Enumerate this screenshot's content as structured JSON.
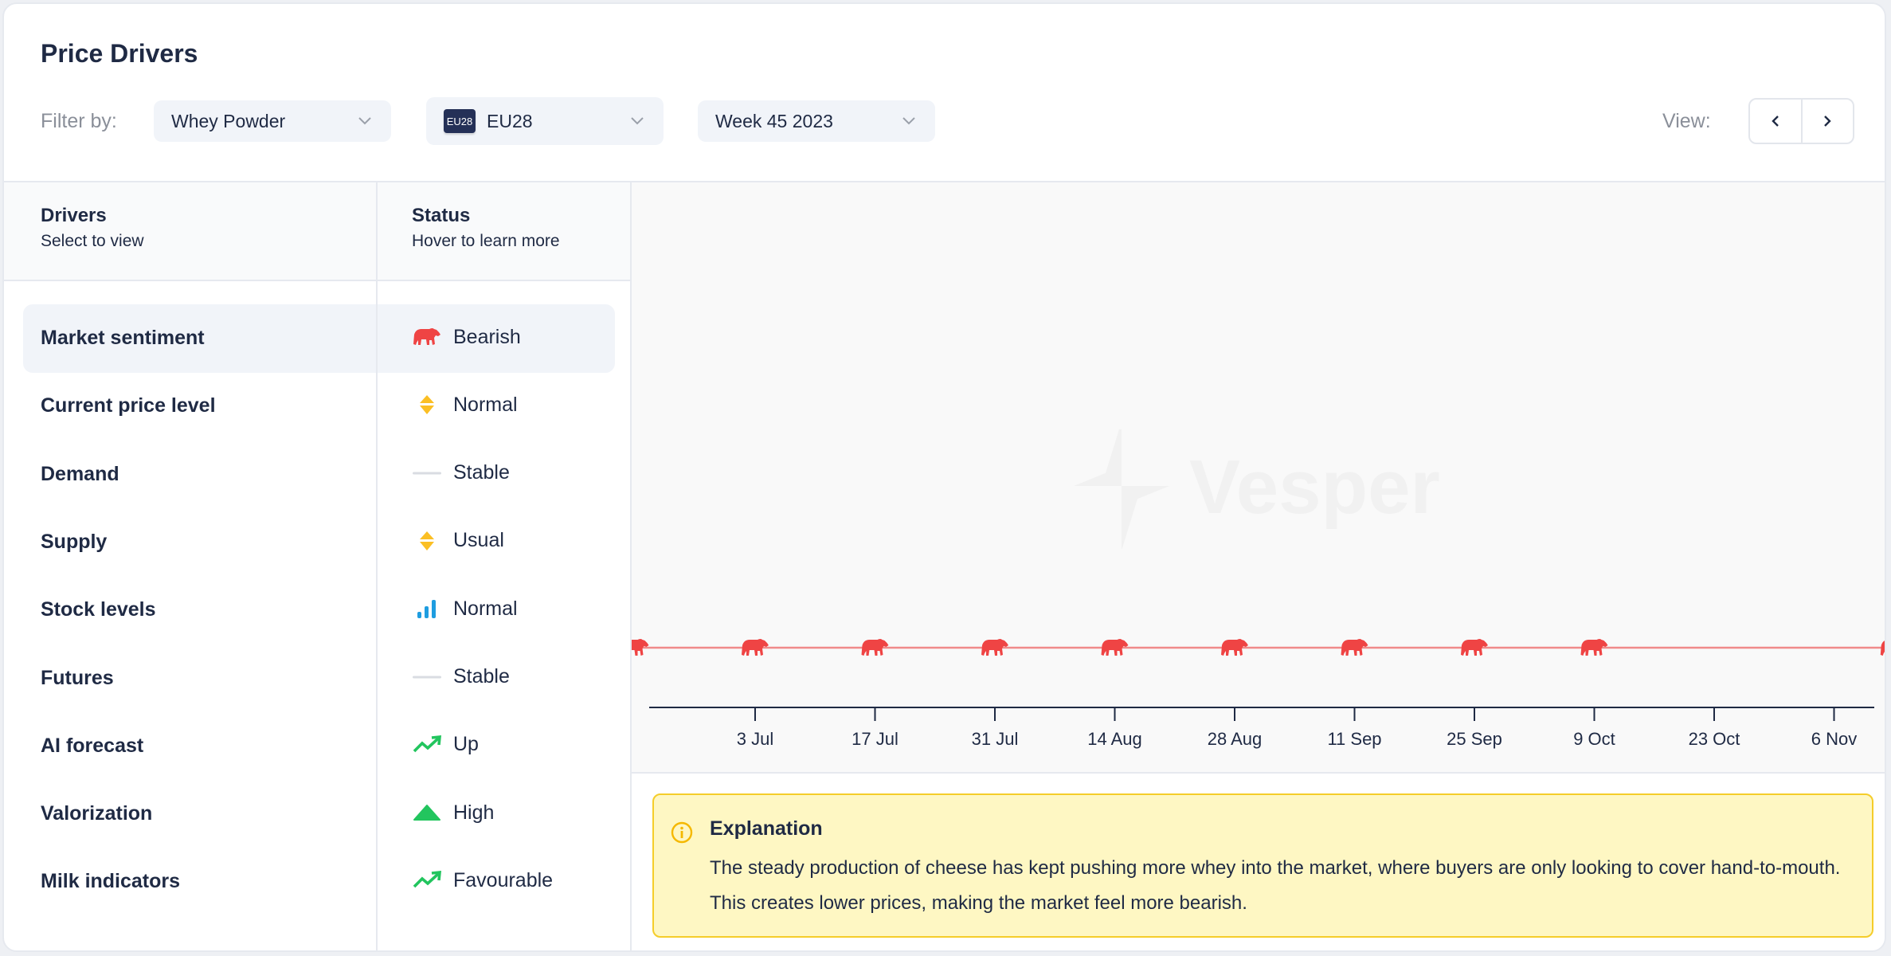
{
  "header": {
    "title": "Price Drivers",
    "filter_label": "Filter by:",
    "product_select": "Whey Powder",
    "region_select": {
      "flag_text": "EU28",
      "value": "EU28"
    },
    "week_select": "Week 45 2023",
    "view_label": "View:",
    "view_prev_icon": "chevron-left-icon",
    "view_next_icon": "chevron-right-icon"
  },
  "table": {
    "drivers_header": {
      "title": "Drivers",
      "subtitle": "Select to view"
    },
    "status_header": {
      "title": "Status",
      "subtitle": "Hover to learn more"
    },
    "selected_index": 0,
    "rows": [
      {
        "driver": "Market sentiment",
        "status": "Bearish",
        "icon": "bear-icon",
        "color": "#ef4444"
      },
      {
        "driver": "Current price level",
        "status": "Normal",
        "icon": "up-down-diamond-icon",
        "color": "#fbbf24"
      },
      {
        "driver": "Demand",
        "status": "Stable",
        "icon": "flat-line-icon",
        "color": "#d9dce2"
      },
      {
        "driver": "Supply",
        "status": "Usual",
        "icon": "up-down-diamond-icon",
        "color": "#fbbf24"
      },
      {
        "driver": "Stock levels",
        "status": "Normal",
        "icon": "bar-signal-icon",
        "color": "#1e9de0"
      },
      {
        "driver": "Futures",
        "status": "Stable",
        "icon": "flat-line-icon",
        "color": "#d9dce2"
      },
      {
        "driver": "AI forecast",
        "status": "Up",
        "icon": "trending-up-icon",
        "color": "#22c55e"
      },
      {
        "driver": "Valorization",
        "status": "High",
        "icon": "triangle-up-icon",
        "color": "#22c55e"
      },
      {
        "driver": "Milk indicators",
        "status": "Favourable",
        "icon": "trending-up-icon",
        "color": "#22c55e"
      }
    ]
  },
  "watermark": {
    "text": "Vesper"
  },
  "chart_data": {
    "type": "line",
    "title": "Market sentiment",
    "series": [
      {
        "name": "Market sentiment",
        "marker": "bear-icon",
        "color": "#ef4444",
        "points": [
          {
            "x": "19 Jun",
            "value": "Bearish"
          },
          {
            "x": "3 Jul",
            "value": "Bearish"
          },
          {
            "x": "17 Jul",
            "value": "Bearish"
          },
          {
            "x": "31 Jul",
            "value": "Bearish"
          },
          {
            "x": "14 Aug",
            "value": "Bearish"
          },
          {
            "x": "28 Aug",
            "value": "Bearish"
          },
          {
            "x": "11 Sep",
            "value": "Bearish"
          },
          {
            "x": "25 Sep",
            "value": "Bearish"
          },
          {
            "x": "9 Oct",
            "value": "Bearish"
          },
          {
            "x": "13 Nov",
            "value": "Bearish"
          }
        ]
      }
    ],
    "x_ticks": [
      "3 Jul",
      "17 Jul",
      "31 Jul",
      "14 Aug",
      "28 Aug",
      "11 Sep",
      "25 Sep",
      "9 Oct",
      "23 Oct",
      "6 Nov"
    ],
    "xlabel": "",
    "ylabel": "",
    "grid": false
  },
  "explanation": {
    "title": "Explanation",
    "text": "The steady production of cheese has kept pushing more whey into the market, where buyers are only looking to cover hand-to-mouth. This creates lower prices, making the market feel more bearish."
  }
}
